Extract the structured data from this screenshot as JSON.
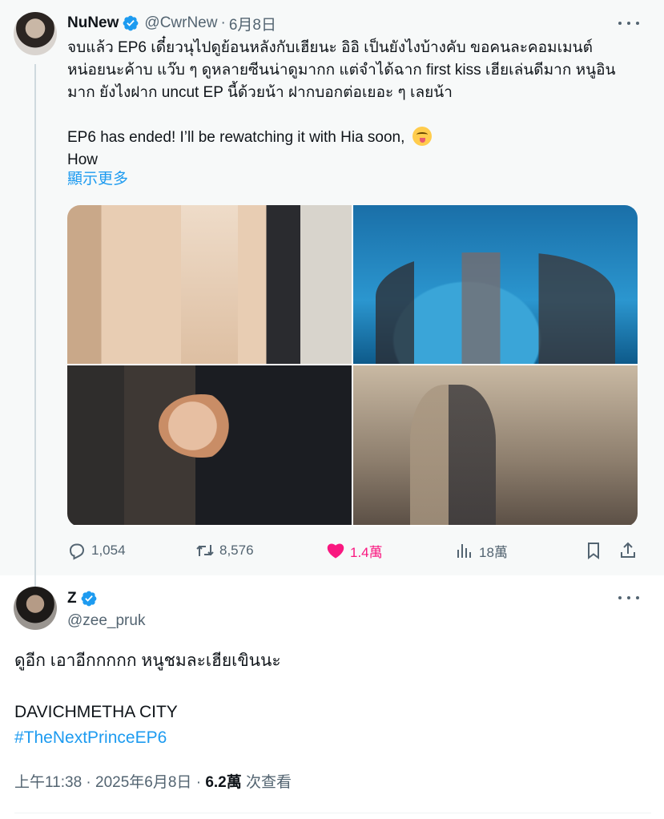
{
  "quoted_tweet": {
    "author_name": "NuNew",
    "author_handle": "@CwrNew",
    "separator": "·",
    "date": "6月8日",
    "text_lines": [
      "จบแล้ว EP6 เดี๋ยวนุไปดูย้อนหลังกับเฮียนะ อิอิ   เป็นยังไงบ้างคับ ขอคนละคอมเมนต์",
      "หน่อยนะค้าบ แว๊บ ๆ ดูหลายซีนน่าดูมากก แต่จำได้ฉาก first kiss เฮียเล่นดีมาก หนูอิน",
      "มาก ยังไงฝาก uncut EP นี้ด้วยน้า ฝากบอกต่อเยอะ ๆ เลยน้า"
    ],
    "english_line": "EP6 has ended! I’ll be rewatching it with Hia soon,",
    "english_line_2": "How",
    "show_more": "顯示更多",
    "stats": {
      "replies": "1,054",
      "retweets": "8,576",
      "likes": "1.4萬",
      "views": "18萬"
    },
    "accent_like": "#f91880"
  },
  "main_tweet": {
    "author_name": "Z",
    "author_handle": "@zee_pruk",
    "text_line_1": "ดูอีก เอาอีกกกกก หนูชมละเฮียเขินนะ",
    "text_line_2": "DAVICHMETHA CITY",
    "hashtag": "#TheNextPrinceEP6",
    "meta_time": "上午11:38 · 2025年6月8日 · ",
    "meta_views": "6.2萬",
    "meta_views_label": " 次查看"
  },
  "colors": {
    "link": "#1d9bf0",
    "verified": "#1d9bf0",
    "muted": "#536471"
  },
  "icons": [
    "verified-badge-icon",
    "more-icon",
    "reply-icon",
    "retweet-icon",
    "heart-icon",
    "views-icon",
    "bookmark-icon",
    "share-icon"
  ]
}
